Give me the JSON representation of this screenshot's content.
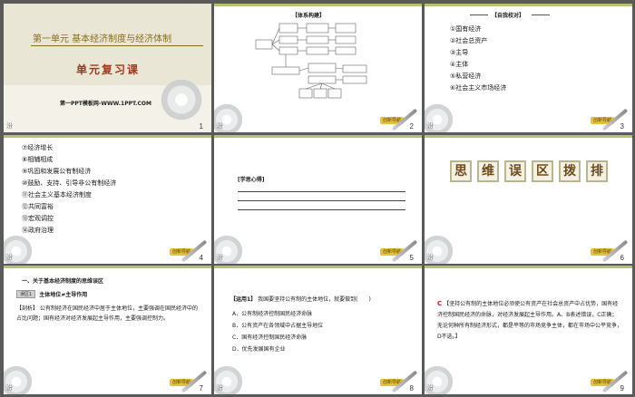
{
  "slides": [
    {
      "num": "1",
      "unit_title": "第一单元  基本经济制度与经济体制",
      "review_title": "单元复习课",
      "watermark": "第一PPT模板网-WWW.1PPT.COM"
    },
    {
      "num": "2",
      "header": "【体系构建】"
    },
    {
      "num": "3",
      "header": "【自我校对】",
      "items": [
        "①国有经济",
        "②社会总资产",
        "③主导",
        "④主体",
        "⑤私营经济",
        "⑥社会主义市场经济"
      ]
    },
    {
      "num": "4",
      "items": [
        "⑦经济增长",
        "⑧相辅相成",
        "⑨巩固和发展公有制经济",
        "⑩鼓励、支持、引导非公有制经济",
        "⑪社会主义基本经济制度",
        "⑫共同富裕",
        "⑬宏观调控",
        "⑭政府治理"
      ]
    },
    {
      "num": "5",
      "header": "[学思心得]"
    },
    {
      "num": "6",
      "banner_chars": [
        "思",
        "维",
        "误",
        "区",
        "拨",
        "排"
      ]
    },
    {
      "num": "7",
      "heading": "一、关于基本经济制度的思维误区",
      "tag": "误区1",
      "subheading": "主体地位≠主导作用",
      "analysis_label": "【剖析】",
      "analysis_text": "公有制经济在国民经济中居于主体地位，主要强调在国民经济中的占比问题；国有经济对经济发展起主导作用，主要强调控制力。"
    },
    {
      "num": "8",
      "question_label": "【运用1】",
      "question": "我国要坚持公有制的主体地位，就要做到(　　)",
      "options": [
        "A．公有制经济控制国民经济命脉",
        "B．公有资产在各领域中占据主导地位",
        "C．国有经济控制国民经济命脉",
        "D．优先发展国有企业"
      ]
    },
    {
      "num": "9",
      "answer": "C",
      "explanation": "【坚持公有制的主体地位必须使公有资产在社会总资产中占优势，国有经济控制国民经济的命脉，对经济发展起主导作用。A、B表述错误，C正确；无论何种所有制经济形式，都是平等的市场竞争主体，都在市场中公平竞争，D不选。】"
    }
  ],
  "footer": {
    "left_glyph": "汾",
    "brand": "创新导航"
  }
}
